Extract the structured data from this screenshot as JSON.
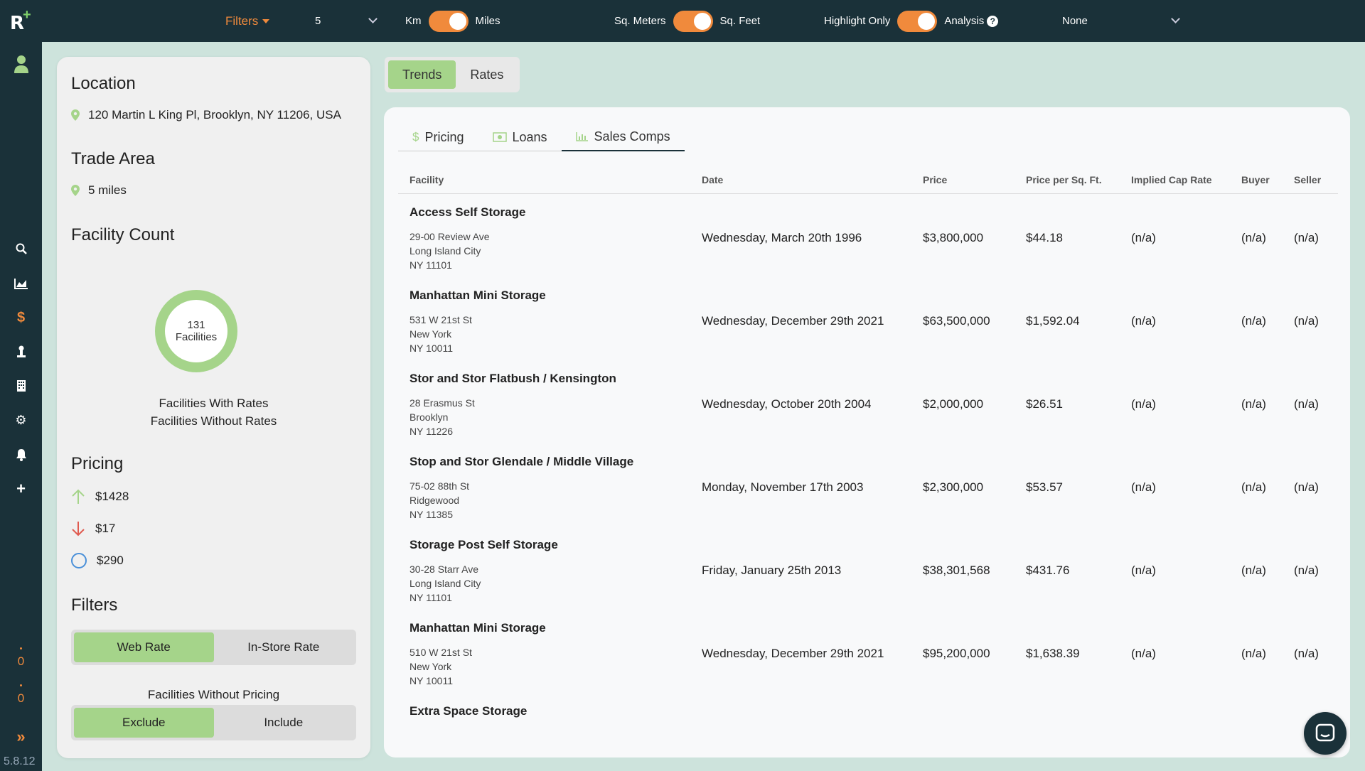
{
  "topbar": {
    "filters_label": "Filters",
    "radius_value": "5",
    "unit_distance": {
      "left": "Km",
      "right": "Miles"
    },
    "unit_area": {
      "left": "Sq. Meters",
      "right": "Sq. Feet"
    },
    "highlight": {
      "left": "Highlight Only",
      "right": "Analysis"
    },
    "help_glyph": "?",
    "analysis_select": "None"
  },
  "leftnav": {
    "counts": [
      "0",
      "0"
    ],
    "version": "5.8.12",
    "expand_glyph": "»"
  },
  "leftpanel": {
    "location_title": "Location",
    "location_address": "120 Martin L King Pl, Brooklyn, NY 11206, USA",
    "trade_area_title": "Trade Area",
    "trade_area_value": "5 miles",
    "facility_count_title": "Facility Count",
    "donut_count": "131",
    "donut_label": "Facilities",
    "with_rates": "Facilities With Rates",
    "without_rates": "Facilities Without Rates",
    "pricing_title": "Pricing",
    "pricing_high": "$1428",
    "pricing_low": "$17",
    "pricing_avg": "$290",
    "filters_title": "Filters",
    "rate_options": [
      "Web Rate",
      "In-Store Rate"
    ],
    "without_pricing_label": "Facilities Without Pricing",
    "pricing_options": [
      "Exclude",
      "Include"
    ]
  },
  "toptabs": [
    "Trends",
    "Rates"
  ],
  "subtabs": [
    {
      "label": "Pricing",
      "icon": "dollar-icon"
    },
    {
      "label": "Loans",
      "icon": "cash-icon"
    },
    {
      "label": "Sales Comps",
      "icon": "bar-chart-icon"
    }
  ],
  "table": {
    "headers": [
      "Facility",
      "Date",
      "Price",
      "Price per Sq. Ft.",
      "Implied Cap Rate",
      "Buyer",
      "Seller"
    ],
    "rows": [
      {
        "name": "Access Self Storage",
        "addr1": "29-00 Review Ave",
        "addr2": "Long Island City",
        "addr3": "NY 11101",
        "date": "Wednesday, March 20th 1996",
        "price": "$3,800,000",
        "ppsf": "$44.18",
        "cap": "(n/a)",
        "buyer": "(n/a)",
        "seller": "(n/a)"
      },
      {
        "name": "Manhattan Mini Storage",
        "addr1": "531 W 21st St",
        "addr2": "New York",
        "addr3": "NY 10011",
        "date": "Wednesday, December 29th 2021",
        "price": "$63,500,000",
        "ppsf": "$1,592.04",
        "cap": "(n/a)",
        "buyer": "(n/a)",
        "seller": "(n/a)"
      },
      {
        "name": "Stor and Stor Flatbush / Kensington",
        "addr1": "28 Erasmus St",
        "addr2": "Brooklyn",
        "addr3": "NY 11226",
        "date": "Wednesday, October 20th 2004",
        "price": "$2,000,000",
        "ppsf": "$26.51",
        "cap": "(n/a)",
        "buyer": "(n/a)",
        "seller": "(n/a)"
      },
      {
        "name": "Stop and Stor Glendale / Middle Village",
        "addr1": "75-02 88th St",
        "addr2": "Ridgewood",
        "addr3": "NY 11385",
        "date": "Monday, November 17th 2003",
        "price": "$2,300,000",
        "ppsf": "$53.57",
        "cap": "(n/a)",
        "buyer": "(n/a)",
        "seller": "(n/a)"
      },
      {
        "name": "Storage Post Self Storage",
        "addr1": "30-28 Starr Ave",
        "addr2": "Long Island City",
        "addr3": "NY 11101",
        "date": "Friday, January 25th 2013",
        "price": "$38,301,568",
        "ppsf": "$431.76",
        "cap": "(n/a)",
        "buyer": "(n/a)",
        "seller": "(n/a)"
      },
      {
        "name": "Manhattan Mini Storage",
        "addr1": "510 W 21st St",
        "addr2": "New York",
        "addr3": "NY 10011",
        "date": "Wednesday, December 29th 2021",
        "price": "$95,200,000",
        "ppsf": "$1,638.39",
        "cap": "(n/a)",
        "buyer": "(n/a)",
        "seller": "(n/a)"
      },
      {
        "name": "Extra Space Storage",
        "addr1": "",
        "addr2": "",
        "addr3": "",
        "date": "",
        "price": "",
        "ppsf": "",
        "cap": "",
        "buyer": "",
        "seller": ""
      }
    ]
  },
  "colors": {
    "accent": "#f08a3c",
    "green": "#a5d48a",
    "navy": "#1a3139"
  }
}
